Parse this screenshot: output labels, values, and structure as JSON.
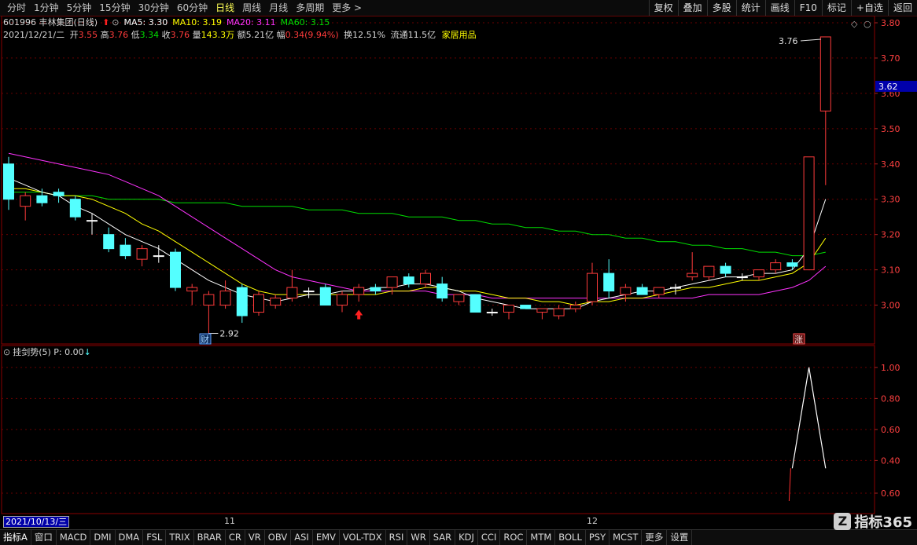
{
  "toolbar": {
    "tabs": [
      "分时",
      "1分钟",
      "5分钟",
      "15分钟",
      "30分钟",
      "60分钟",
      "日线",
      "周线",
      "月线",
      "多周期",
      "更多 >"
    ],
    "active_tab": "日线",
    "tools": [
      "复权",
      "叠加",
      "多股",
      "统计",
      "画线",
      "F10",
      "标记",
      "+自选",
      "返回"
    ]
  },
  "header": {
    "code_name": "601996 丰林集团(日线)",
    "ma": [
      {
        "label": "MA5: 3.30",
        "color": "#ffffff"
      },
      {
        "label": "MA10: 3.19",
        "color": "#ffff00"
      },
      {
        "label": "MA20: 3.11",
        "color": "#ff33ff"
      },
      {
        "label": "MA60: 3.15",
        "color": "#00dd00"
      }
    ],
    "date": "2021/12/21/二",
    "open_label": "开",
    "open": "3.55",
    "high_label": "高",
    "high": "3.76",
    "low_label": "低",
    "low": "3.34",
    "close_label": "收",
    "close": "3.76",
    "vol_label": "量",
    "vol": "143.3万",
    "amount_label": "额",
    "amount": "5.21亿",
    "range_label": "幅",
    "range": "0.34(9.94%)",
    "turnover_label": "换",
    "turnover": "12.51%",
    "float_label": "流通",
    "float": "11.5亿",
    "sector": "家居用品"
  },
  "price_axis": {
    "labels": [
      "3.80",
      "3.70",
      "3.60",
      "3.50",
      "3.40",
      "3.30",
      "3.20",
      "3.10",
      "3.00"
    ],
    "current_tag": "3.62"
  },
  "annotations": {
    "high_label": "3.76",
    "low_label": "2.92",
    "marker_cai": "财",
    "marker_zhang": "涨"
  },
  "indicator": {
    "title": "挂剑势(5) P: 0.00",
    "axis": [
      "1.00",
      "0.80",
      "0.60",
      "0.40",
      "0.60"
    ]
  },
  "date_axis": {
    "start": "2021/10/13/三",
    "ticks": [
      "11",
      "12"
    ]
  },
  "bottom_tabs": [
    "指标A",
    "窗口",
    "MACD",
    "DMI",
    "DMA",
    "FSL",
    "TRIX",
    "BRAR",
    "CR",
    "VR",
    "OBV",
    "ASI",
    "EMV",
    "VOL-TDX",
    "RSI",
    "WR",
    "SAR",
    "KDJ",
    "CCI",
    "ROC",
    "MTM",
    "BOLL",
    "PSY",
    "MCST",
    "更多",
    "设置"
  ],
  "watermark": {
    "logo": "Z",
    "text": "指标365"
  },
  "colors": {
    "up": "#ff3b3b",
    "down": "#54ffff",
    "flat": "#ffffff",
    "ma5": "#ffffff",
    "ma10": "#ffff00",
    "ma20": "#ff33ff",
    "ma60": "#00dd00",
    "frame": "#8a0000",
    "grid": "#6a0000"
  },
  "chart_data": {
    "type": "candlestick",
    "ylim": [
      2.89,
      3.82
    ],
    "candles": [
      {
        "o": 3.4,
        "h": 3.42,
        "l": 3.27,
        "c": 3.3
      },
      {
        "o": 3.28,
        "h": 3.32,
        "l": 3.24,
        "c": 3.31
      },
      {
        "o": 3.31,
        "h": 3.33,
        "l": 3.28,
        "c": 3.29
      },
      {
        "o": 3.32,
        "h": 3.33,
        "l": 3.29,
        "c": 3.31
      },
      {
        "o": 3.3,
        "h": 3.31,
        "l": 3.24,
        "c": 3.25
      },
      {
        "o": 3.24,
        "h": 3.26,
        "l": 3.2,
        "c": 3.24
      },
      {
        "o": 3.2,
        "h": 3.22,
        "l": 3.15,
        "c": 3.16
      },
      {
        "o": 3.17,
        "h": 3.19,
        "l": 3.13,
        "c": 3.14
      },
      {
        "o": 3.13,
        "h": 3.17,
        "l": 3.11,
        "c": 3.16
      },
      {
        "o": 3.14,
        "h": 3.17,
        "l": 3.12,
        "c": 3.14
      },
      {
        "o": 3.15,
        "h": 3.16,
        "l": 3.04,
        "c": 3.05
      },
      {
        "o": 3.04,
        "h": 3.06,
        "l": 3.0,
        "c": 3.05
      },
      {
        "o": 3.0,
        "h": 3.04,
        "l": 2.92,
        "c": 3.03
      },
      {
        "o": 3.0,
        "h": 3.07,
        "l": 2.99,
        "c": 3.04
      },
      {
        "o": 3.05,
        "h": 3.06,
        "l": 2.95,
        "c": 2.97
      },
      {
        "o": 2.98,
        "h": 3.04,
        "l": 2.97,
        "c": 3.03
      },
      {
        "o": 3.0,
        "h": 3.03,
        "l": 2.99,
        "c": 3.02
      },
      {
        "o": 3.02,
        "h": 3.1,
        "l": 3.01,
        "c": 3.05
      },
      {
        "o": 3.04,
        "h": 3.05,
        "l": 3.02,
        "c": 3.04
      },
      {
        "o": 3.05,
        "h": 3.06,
        "l": 3.0,
        "c": 3.0
      },
      {
        "o": 3.0,
        "h": 3.04,
        "l": 2.98,
        "c": 3.03
      },
      {
        "o": 3.03,
        "h": 3.06,
        "l": 3.01,
        "c": 3.05
      },
      {
        "o": 3.05,
        "h": 3.06,
        "l": 3.03,
        "c": 3.04
      },
      {
        "o": 3.05,
        "h": 3.08,
        "l": 3.03,
        "c": 3.08
      },
      {
        "o": 3.08,
        "h": 3.09,
        "l": 3.05,
        "c": 3.06
      },
      {
        "o": 3.06,
        "h": 3.1,
        "l": 3.05,
        "c": 3.09
      },
      {
        "o": 3.06,
        "h": 3.08,
        "l": 3.01,
        "c": 3.02
      },
      {
        "o": 3.01,
        "h": 3.03,
        "l": 3.0,
        "c": 3.03
      },
      {
        "o": 3.03,
        "h": 3.03,
        "l": 2.98,
        "c": 2.98
      },
      {
        "o": 2.98,
        "h": 2.99,
        "l": 2.97,
        "c": 2.98
      },
      {
        "o": 2.98,
        "h": 3.0,
        "l": 2.96,
        "c": 3.0
      },
      {
        "o": 3.0,
        "h": 3.0,
        "l": 2.99,
        "c": 2.99
      },
      {
        "o": 2.98,
        "h": 2.99,
        "l": 2.96,
        "c": 2.99
      },
      {
        "o": 2.97,
        "h": 3.0,
        "l": 2.96,
        "c": 2.99
      },
      {
        "o": 2.99,
        "h": 3.01,
        "l": 2.98,
        "c": 3.0
      },
      {
        "o": 3.01,
        "h": 3.12,
        "l": 3.0,
        "c": 3.09
      },
      {
        "o": 3.09,
        "h": 3.13,
        "l": 3.02,
        "c": 3.04
      },
      {
        "o": 3.03,
        "h": 3.06,
        "l": 3.01,
        "c": 3.05
      },
      {
        "o": 3.05,
        "h": 3.06,
        "l": 3.03,
        "c": 3.03
      },
      {
        "o": 3.03,
        "h": 3.05,
        "l": 3.02,
        "c": 3.05
      },
      {
        "o": 3.05,
        "h": 3.06,
        "l": 3.03,
        "c": 3.05
      },
      {
        "o": 3.08,
        "h": 3.15,
        "l": 3.07,
        "c": 3.09
      },
      {
        "o": 3.08,
        "h": 3.11,
        "l": 3.07,
        "c": 3.11
      },
      {
        "o": 3.11,
        "h": 3.12,
        "l": 3.08,
        "c": 3.09
      },
      {
        "o": 3.08,
        "h": 3.09,
        "l": 3.07,
        "c": 3.08
      },
      {
        "o": 3.08,
        "h": 3.1,
        "l": 3.07,
        "c": 3.1
      },
      {
        "o": 3.1,
        "h": 3.13,
        "l": 3.09,
        "c": 3.12
      },
      {
        "o": 3.12,
        "h": 3.13,
        "l": 3.1,
        "c": 3.11
      },
      {
        "o": 3.1,
        "h": 3.42,
        "l": 3.1,
        "c": 3.42
      },
      {
        "o": 3.55,
        "h": 3.76,
        "l": 3.34,
        "c": 3.76
      }
    ],
    "ma5": [
      3.36,
      3.34,
      3.32,
      3.31,
      3.28,
      3.26,
      3.23,
      3.2,
      3.18,
      3.16,
      3.13,
      3.1,
      3.07,
      3.05,
      3.03,
      3.02,
      3.01,
      3.02,
      3.03,
      3.03,
      3.04,
      3.04,
      3.05,
      3.05,
      3.06,
      3.06,
      3.05,
      3.04,
      3.02,
      3.01,
      3.0,
      2.99,
      2.99,
      2.99,
      2.99,
      3.01,
      3.02,
      3.03,
      3.04,
      3.04,
      3.05,
      3.06,
      3.07,
      3.08,
      3.08,
      3.09,
      3.09,
      3.1,
      3.16,
      3.3
    ],
    "ma10": [
      3.33,
      3.33,
      3.32,
      3.31,
      3.31,
      3.3,
      3.28,
      3.26,
      3.23,
      3.21,
      3.18,
      3.15,
      3.12,
      3.09,
      3.06,
      3.04,
      3.03,
      3.03,
      3.03,
      3.03,
      3.03,
      3.03,
      3.03,
      3.04,
      3.04,
      3.05,
      3.05,
      3.04,
      3.04,
      3.03,
      3.02,
      3.02,
      3.01,
      3.01,
      3.0,
      3.01,
      3.01,
      3.02,
      3.02,
      3.03,
      3.04,
      3.05,
      3.05,
      3.06,
      3.07,
      3.07,
      3.08,
      3.09,
      3.12,
      3.19
    ],
    "ma20": [
      3.43,
      3.42,
      3.41,
      3.4,
      3.39,
      3.38,
      3.37,
      3.35,
      3.33,
      3.31,
      3.28,
      3.25,
      3.22,
      3.19,
      3.16,
      3.13,
      3.1,
      3.08,
      3.07,
      3.06,
      3.05,
      3.04,
      3.04,
      3.04,
      3.04,
      3.04,
      3.03,
      3.03,
      3.03,
      3.02,
      3.02,
      3.02,
      3.02,
      3.02,
      3.02,
      3.02,
      3.02,
      3.02,
      3.02,
      3.02,
      3.02,
      3.02,
      3.03,
      3.03,
      3.03,
      3.03,
      3.04,
      3.05,
      3.07,
      3.11
    ],
    "ma60": [
      3.32,
      3.32,
      3.32,
      3.31,
      3.31,
      3.31,
      3.3,
      3.3,
      3.3,
      3.3,
      3.29,
      3.29,
      3.29,
      3.29,
      3.28,
      3.28,
      3.28,
      3.28,
      3.27,
      3.27,
      3.27,
      3.26,
      3.26,
      3.26,
      3.25,
      3.25,
      3.25,
      3.24,
      3.24,
      3.23,
      3.23,
      3.22,
      3.22,
      3.21,
      3.21,
      3.2,
      3.2,
      3.19,
      3.19,
      3.18,
      3.18,
      3.17,
      3.17,
      3.16,
      3.16,
      3.15,
      3.15,
      3.14,
      3.14,
      3.15
    ],
    "indicator_ylim": [
      0.25,
      1.05
    ],
    "indicator_points": [
      {
        "i": 47,
        "v": 0.35
      },
      {
        "i": 48,
        "v": 1.0
      },
      {
        "i": 49,
        "v": 0.35
      }
    ]
  }
}
